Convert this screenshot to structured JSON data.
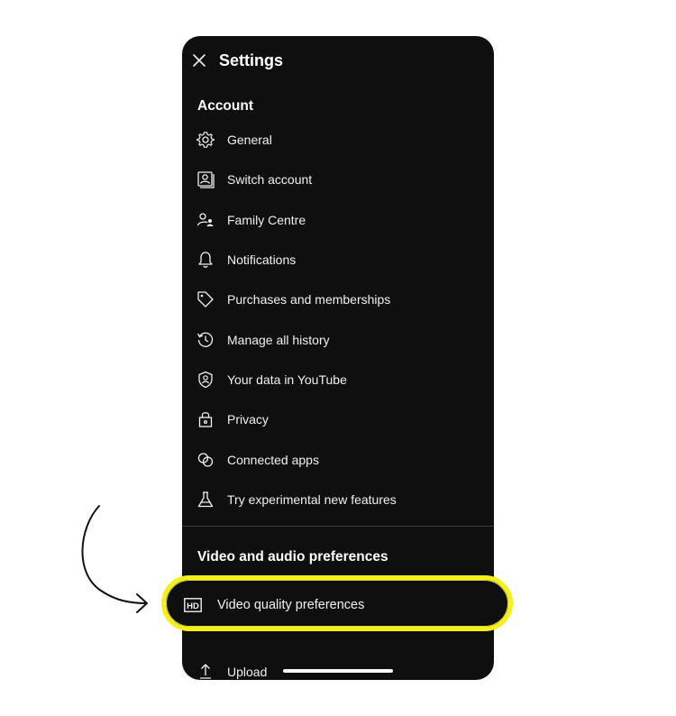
{
  "header": {
    "title": "Settings",
    "close_icon": "close-icon"
  },
  "account": {
    "title": "Account",
    "items": [
      {
        "label": "General",
        "icon": "gear-icon"
      },
      {
        "label": "Switch account",
        "icon": "switch-account-icon"
      },
      {
        "label": "Family Centre",
        "icon": "family-icon"
      },
      {
        "label": "Notifications",
        "icon": "bell-icon"
      },
      {
        "label": "Purchases and memberships",
        "icon": "tag-icon"
      },
      {
        "label": "Manage all history",
        "icon": "history-icon"
      },
      {
        "label": "Your data in YouTube",
        "icon": "shield-person-icon"
      },
      {
        "label": "Privacy",
        "icon": "lock-icon"
      },
      {
        "label": "Connected apps",
        "icon": "connected-apps-icon"
      },
      {
        "label": "Try experimental new features",
        "icon": "flask-icon"
      }
    ]
  },
  "video_audio": {
    "title": "Video and audio preferences",
    "items": [
      {
        "label": "Video quality preferences",
        "icon": "hd-icon"
      },
      {
        "label": "Upload",
        "icon": "upload-icon"
      }
    ]
  },
  "colors": {
    "background": "#0f0f0f",
    "highlight": "#f5ef1a",
    "text": "#f1f1f1"
  }
}
